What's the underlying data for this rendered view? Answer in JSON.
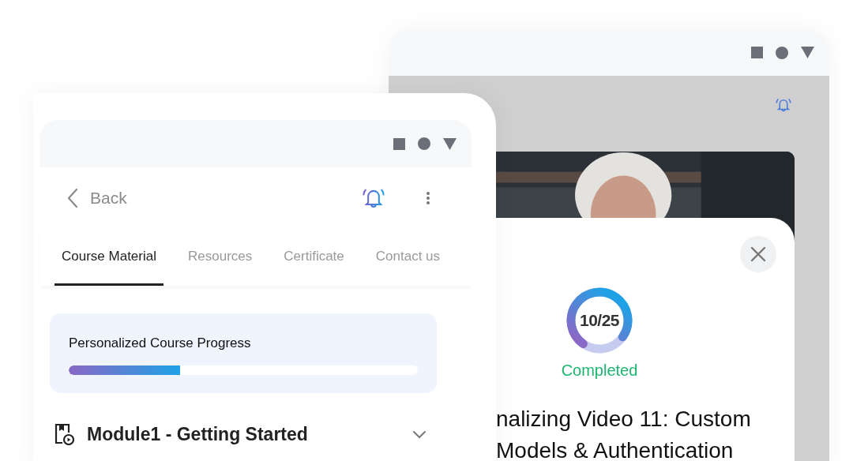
{
  "front_window": {
    "header": {
      "back_label": "Back"
    },
    "tabs": [
      {
        "label": "Course Material",
        "selected": true
      },
      {
        "label": "Resources",
        "selected": false
      },
      {
        "label": "Certificate",
        "selected": false
      },
      {
        "label": "Contact us",
        "selected": false
      }
    ],
    "progress_card": {
      "title": "Personalized Course Progress",
      "level": 0.32
    },
    "module": {
      "title": "Module1 - Getting Started",
      "expanded": false
    }
  },
  "back_window": {
    "completion": {
      "count": "10/25",
      "level": 0.75,
      "status": "Completed"
    },
    "video_title": "nalizing Video 11: Custom Models & Authentication"
  }
}
